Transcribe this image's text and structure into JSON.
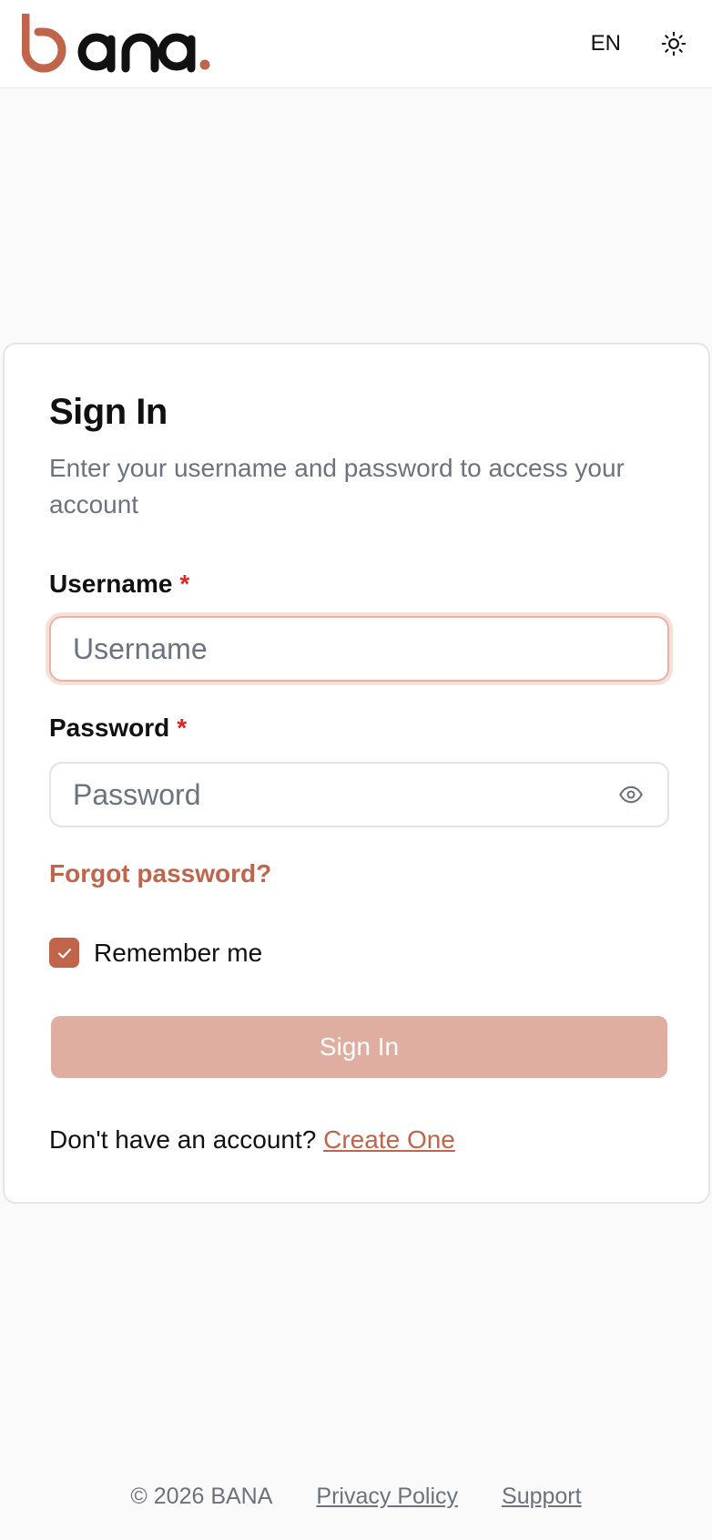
{
  "header": {
    "logo_text": "bana.",
    "language": "EN",
    "theme_icon": "sun-icon",
    "colors": {
      "logo_accent": "#c0654c",
      "logo_dark": "#111111"
    }
  },
  "signin": {
    "title": "Sign In",
    "description": "Enter your username and password to access your account",
    "username_label": "Username",
    "username_required": "*",
    "username_placeholder": "Username",
    "username_value": "",
    "password_label": "Password",
    "password_required": "*",
    "password_placeholder": "Password",
    "password_value": "",
    "password_toggle_icon": "eye-icon",
    "forgot_password": "Forgot password?",
    "remember_me": "Remember me",
    "remember_checked": true,
    "submit_label": "Sign In",
    "no_account_text": "Don't have an account?",
    "create_account_link": "Create One"
  },
  "footer": {
    "copyright": "© 2026 BANA",
    "privacy_link": "Privacy Policy",
    "support_link": "Support"
  },
  "colors": {
    "accent": "#c0654c",
    "button_disabled": "#e0aea0",
    "required": "#dc2626",
    "muted_text": "#6b7280"
  }
}
